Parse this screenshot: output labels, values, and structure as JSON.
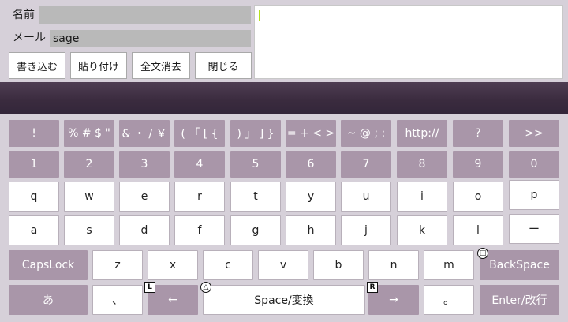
{
  "form": {
    "name_label": "名前",
    "name_value": "",
    "mail_label": "メール",
    "mail_value": "sage",
    "message_value": ""
  },
  "buttons": {
    "write": "書き込む",
    "paste": "貼り付け",
    "clear_all": "全文消去",
    "close": "閉じる"
  },
  "keyboard": {
    "symbols": [
      "!",
      "% # $ \"",
      "& ・ / ￥",
      "( 「 [ {",
      ") 」 ] }",
      "= + < >",
      "~ @ ; :",
      "http://",
      "?",
      ">>"
    ],
    "digits": [
      "1",
      "2",
      "3",
      "4",
      "5",
      "6",
      "7",
      "8",
      "9",
      "0"
    ],
    "row_q": [
      "q",
      "w",
      "e",
      "r",
      "t",
      "y",
      "u",
      "i",
      "o",
      "p"
    ],
    "row_a": [
      "a",
      "s",
      "d",
      "f",
      "g",
      "h",
      "j",
      "k",
      "l",
      "ー"
    ],
    "capslock": "CapsLock",
    "row_z": [
      "z",
      "x",
      "c",
      "v",
      "b",
      "n",
      "m"
    ],
    "backspace": "BackSpace",
    "hiragana": "あ",
    "comma": "、",
    "left_arrow": "←",
    "space": "Space/変換",
    "right_arrow": "→",
    "period": "。",
    "enter": "Enter/改行"
  },
  "badges": {
    "l": "L",
    "r": "R",
    "triangle": "△",
    "square": "□"
  }
}
